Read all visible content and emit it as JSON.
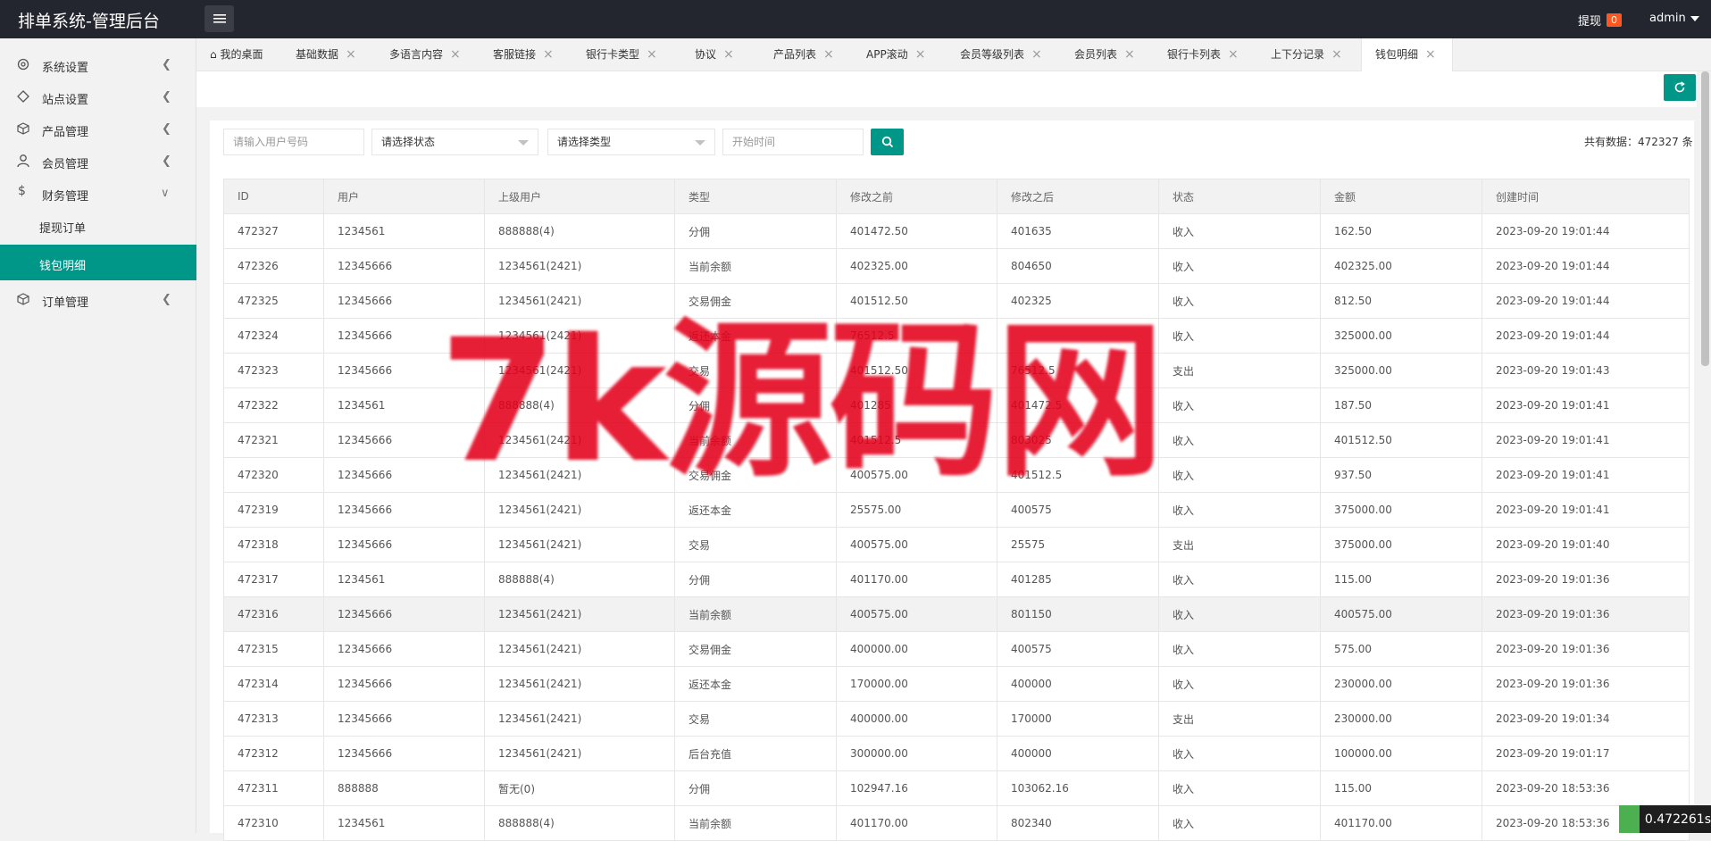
{
  "header": {
    "brand": "排单系统-管理后台",
    "withdraw_label": "提现",
    "withdraw_count": "0",
    "user": "admin"
  },
  "sidebar": {
    "items": [
      {
        "label": "系统设置",
        "icon": "gear-icon"
      },
      {
        "label": "站点设置",
        "icon": "site-icon"
      },
      {
        "label": "产品管理",
        "icon": "cube-icon"
      },
      {
        "label": "会员管理",
        "icon": "user-icon"
      },
      {
        "label": "财务管理",
        "icon": "dollar-icon"
      },
      {
        "label": "提现订单",
        "icon": ""
      },
      {
        "label": "钱包明细",
        "icon": ""
      },
      {
        "label": "订单管理",
        "icon": "cube-icon"
      }
    ]
  },
  "tabs": [
    "我的桌面",
    "基础数据",
    "多语言内容",
    "客服链接",
    "银行卡类型",
    "协议",
    "产品列表",
    "APP滚动",
    "会员等级列表",
    "会员列表",
    "银行卡列表",
    "上下分记录",
    "钱包明细"
  ],
  "filters": {
    "user_placeholder": "请输入用户号码",
    "status_placeholder": "请选择状态",
    "type_placeholder": "请选择类型",
    "time_placeholder": "开始时间"
  },
  "total": "共有数据：472327 条",
  "table": {
    "headers": [
      "ID",
      "用户",
      "上级用户",
      "类型",
      "修改之前",
      "修改之后",
      "状态",
      "金额",
      "创建时间"
    ],
    "rows": [
      [
        "472327",
        "1234561",
        "888888(4)",
        "分佣",
        "401472.50",
        "401635",
        "收入",
        "162.50",
        "2023-09-20 19:01:44"
      ],
      [
        "472326",
        "12345666",
        "1234561(2421)",
        "当前余额",
        "402325.00",
        "804650",
        "收入",
        "402325.00",
        "2023-09-20 19:01:44"
      ],
      [
        "472325",
        "12345666",
        "1234561(2421)",
        "交易佣金",
        "401512.50",
        "402325",
        "收入",
        "812.50",
        "2023-09-20 19:01:44"
      ],
      [
        "472324",
        "12345666",
        "1234561(2421)",
        "返还本金",
        "76512.5",
        "",
        "收入",
        "325000.00",
        "2023-09-20 19:01:44"
      ],
      [
        "472323",
        "12345666",
        "1234561(2421)",
        "交易",
        "401512.50",
        "76512.5",
        "支出",
        "325000.00",
        "2023-09-20 19:01:43"
      ],
      [
        "472322",
        "1234561",
        "888888(4)",
        "分佣",
        "401285",
        "401472.5",
        "收入",
        "187.50",
        "2023-09-20 19:01:41"
      ],
      [
        "472321",
        "12345666",
        "1234561(2421)",
        "当前余额",
        "401512.5",
        "803025",
        "收入",
        "401512.50",
        "2023-09-20 19:01:41"
      ],
      [
        "472320",
        "12345666",
        "1234561(2421)",
        "交易佣金",
        "400575.00",
        "401512.5",
        "收入",
        "937.50",
        "2023-09-20 19:01:41"
      ],
      [
        "472319",
        "12345666",
        "1234561(2421)",
        "返还本金",
        "25575.00",
        "400575",
        "收入",
        "375000.00",
        "2023-09-20 19:01:41"
      ],
      [
        "472318",
        "12345666",
        "1234561(2421)",
        "交易",
        "400575.00",
        "25575",
        "支出",
        "375000.00",
        "2023-09-20 19:01:40"
      ],
      [
        "472317",
        "1234561",
        "888888(4)",
        "分佣",
        "401170.00",
        "401285",
        "收入",
        "115.00",
        "2023-09-20 19:01:36"
      ],
      [
        "472316",
        "12345666",
        "1234561(2421)",
        "当前余额",
        "400575.00",
        "801150",
        "收入",
        "400575.00",
        "2023-09-20 19:01:36"
      ],
      [
        "472315",
        "12345666",
        "1234561(2421)",
        "交易佣金",
        "400000.00",
        "400575",
        "收入",
        "575.00",
        "2023-09-20 19:01:36"
      ],
      [
        "472314",
        "12345666",
        "1234561(2421)",
        "返还本金",
        "170000.00",
        "400000",
        "收入",
        "230000.00",
        "2023-09-20 19:01:36"
      ],
      [
        "472313",
        "12345666",
        "1234561(2421)",
        "交易",
        "400000.00",
        "170000",
        "支出",
        "230000.00",
        "2023-09-20 19:01:34"
      ],
      [
        "472312",
        "12345666",
        "1234561(2421)",
        "后台充值",
        "300000.00",
        "400000",
        "收入",
        "100000.00",
        "2023-09-20 19:01:17"
      ],
      [
        "472311",
        "888888",
        "暂无(0)",
        "分佣",
        "102947.16",
        "103062.16",
        "收入",
        "115.00",
        "2023-09-20 18:53:36"
      ],
      [
        "472310",
        "1234561",
        "888888(4)",
        "当前余额",
        "401170.00",
        "802340",
        "收入",
        "401170.00",
        "2023-09-20 18:53:36"
      ]
    ]
  },
  "watermark": "7k源码网",
  "timer": "0.472261s",
  "colors": {
    "accent": "#009688",
    "topbar": "#23262e",
    "badge": "#ff5722",
    "watermark": "#e3001b"
  }
}
